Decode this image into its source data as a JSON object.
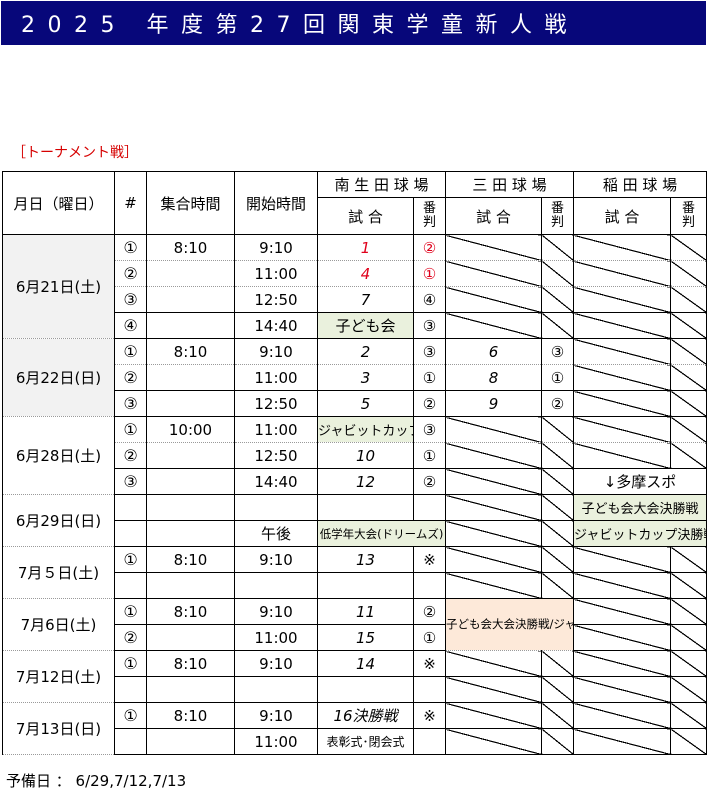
{
  "title": "2025 年度第27回関東学童新人戦",
  "caption": "［トーナメント戦］",
  "header": {
    "date": "月日（曜日）",
    "no": "#",
    "gather": "集合時間",
    "start": "開始時間",
    "venue1": "南 生 田 球 場",
    "venue2": "三 田 球 場",
    "venue3": "稲 田 球 場",
    "game": "試 合",
    "ump1": "番",
    "ump2": "判"
  },
  "days": [
    {
      "date": "6月21日(土)",
      "rows": [
        {
          "no": "①",
          "gather": "8:10",
          "start": "9:10",
          "g1": "1",
          "u1": "②"
        },
        {
          "no": "②",
          "gather": "",
          "start": "11:00",
          "g1": "4",
          "u1": "①"
        },
        {
          "no": "③",
          "gather": "",
          "start": "12:50",
          "g1": "7",
          "u1": "④"
        },
        {
          "no": "④",
          "gather": "",
          "start": "14:40",
          "g1": "子ども会",
          "u1": "③"
        }
      ]
    },
    {
      "date": "6月22日(日)",
      "rows": [
        {
          "no": "①",
          "gather": "8:10",
          "start": "9:10",
          "g1": "2",
          "u1": "③",
          "g2": "6",
          "u2": "③"
        },
        {
          "no": "②",
          "gather": "",
          "start": "11:00",
          "g1": "3",
          "u1": "①",
          "g2": "8",
          "u2": "①"
        },
        {
          "no": "③",
          "gather": "",
          "start": "12:50",
          "g1": "5",
          "u1": "②",
          "g2": "9",
          "u2": "②"
        }
      ]
    },
    {
      "date": "6月28日(土)",
      "rows": [
        {
          "no": "①",
          "gather": "10:00",
          "start": "11:00",
          "g1": "ジャビットカップ",
          "u1": "③"
        },
        {
          "no": "②",
          "gather": "",
          "start": "12:50",
          "g1": "10",
          "u1": "①"
        },
        {
          "no": "③",
          "gather": "",
          "start": "14:40",
          "g1": "12",
          "u1": "②",
          "g3": "↓多摩スポ"
        }
      ]
    },
    {
      "date": "6月29日(日)",
      "rows": [
        {
          "start": "",
          "g3": "子ども会大会決勝戦"
        },
        {
          "start": "午後",
          "g1": "低学年大会(ドリームズ)",
          "g3": "ジャビットカップ決勝戦"
        }
      ]
    },
    {
      "date": "7月５日(土)",
      "rows": [
        {
          "no": "①",
          "gather": "8:10",
          "start": "9:10",
          "g1": "13",
          "u1": "※"
        }
      ]
    },
    {
      "date": "7月6日(土)",
      "rows": [
        {
          "no": "①",
          "gather": "8:10",
          "start": "9:10",
          "g1": "11",
          "u1": "②"
        },
        {
          "no": "②",
          "gather": "",
          "start": "11:00",
          "g1": "15",
          "u1": "①"
        }
      ],
      "g2": "子ども会大会決勝戦/ジャビットカップ決勝予備日"
    },
    {
      "date": "7月12日(土)",
      "rows": [
        {
          "no": "①",
          "gather": "8:10",
          "start": "9:10",
          "g1": "14",
          "u1": "※"
        }
      ]
    },
    {
      "date": "7月13日(日)",
      "rows": [
        {
          "no": "①",
          "gather": "8:10",
          "start": "9:10",
          "g1": "16決勝戦",
          "u1": "※"
        },
        {
          "start": "11:00",
          "g1": "表彰式･閉会式"
        }
      ]
    }
  ],
  "footer": "予備日 ： 6/29,7/12,7/13"
}
